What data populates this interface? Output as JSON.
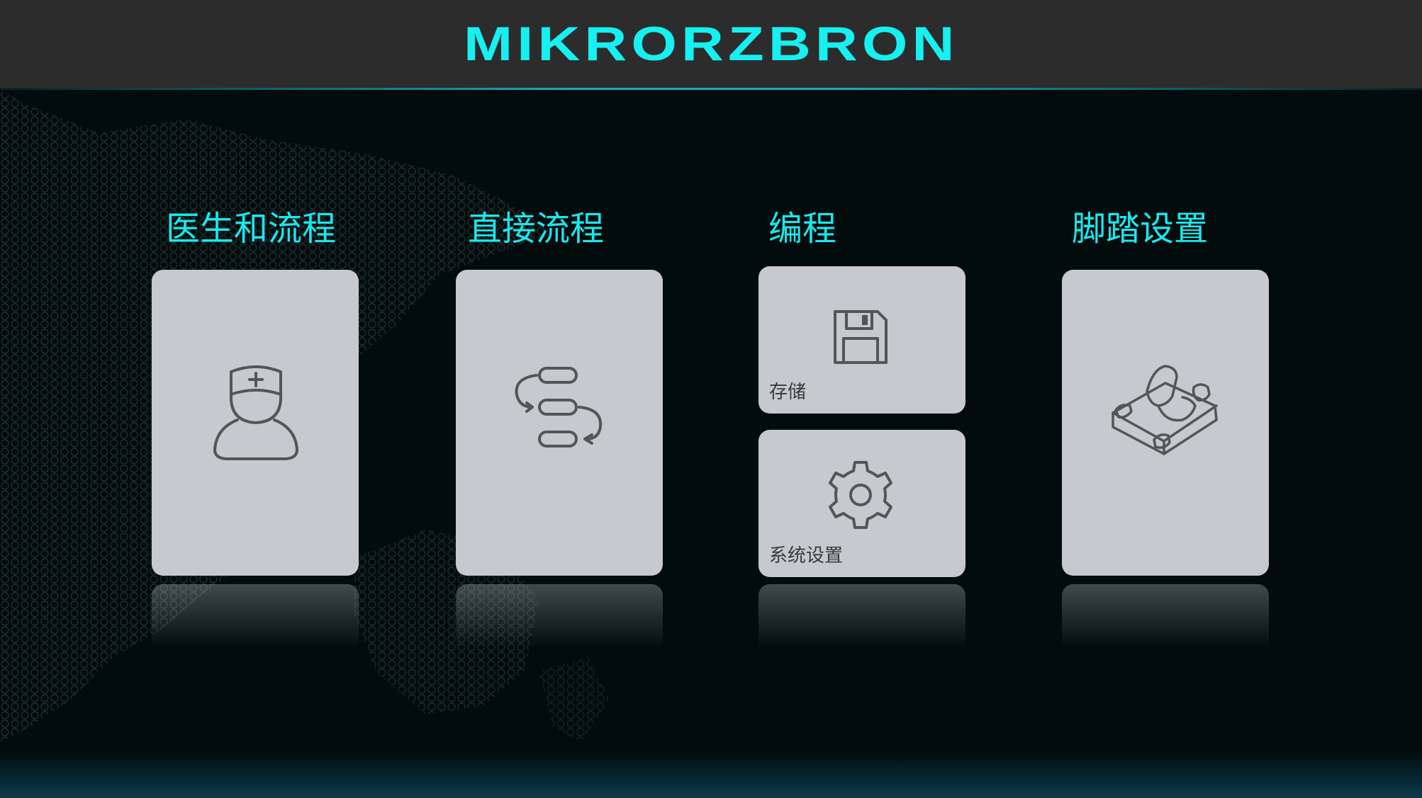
{
  "header": {
    "logo_text": "MIKRORZBRON"
  },
  "sections": [
    {
      "title": "医生和流程",
      "icon": "doctor-icon"
    },
    {
      "title": "直接流程",
      "icon": "flow-icon"
    },
    {
      "title": "编程",
      "subcards": [
        {
          "label": "存储",
          "icon": "floppy-disk-icon"
        },
        {
          "label": "系统设置",
          "icon": "gear-icon"
        }
      ]
    },
    {
      "title": "脚踏设置",
      "icon": "foot-pedal-icon"
    }
  ],
  "colors": {
    "accent": "#19e8ee",
    "header_bg": "#2c2c2c",
    "card_bg": "#c6c9ce",
    "page_bg": "#020c0c",
    "icon_stroke": "#555555"
  }
}
